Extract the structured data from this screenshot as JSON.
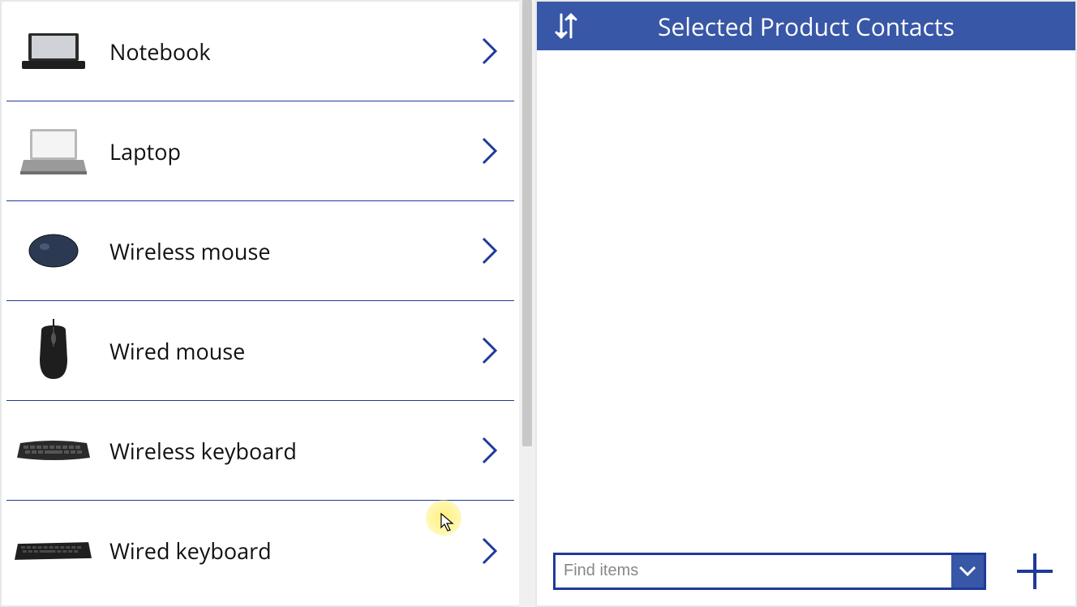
{
  "colors": {
    "accent": "#1f3a9a",
    "headerBg": "#3857a6",
    "headerText": "#ffffff"
  },
  "left": {
    "products": [
      {
        "label": "Notebook",
        "icon": "notebook-thin"
      },
      {
        "label": "Laptop",
        "icon": "laptop"
      },
      {
        "label": "Wireless mouse",
        "icon": "mouse-rounded"
      },
      {
        "label": "Wired mouse",
        "icon": "mouse-wired"
      },
      {
        "label": "Wireless keyboard",
        "icon": "keyboard"
      },
      {
        "label": "Wired keyboard",
        "icon": "keyboard-long"
      }
    ]
  },
  "right": {
    "title": "Selected Product Contacts",
    "find_placeholder": "Find items"
  }
}
